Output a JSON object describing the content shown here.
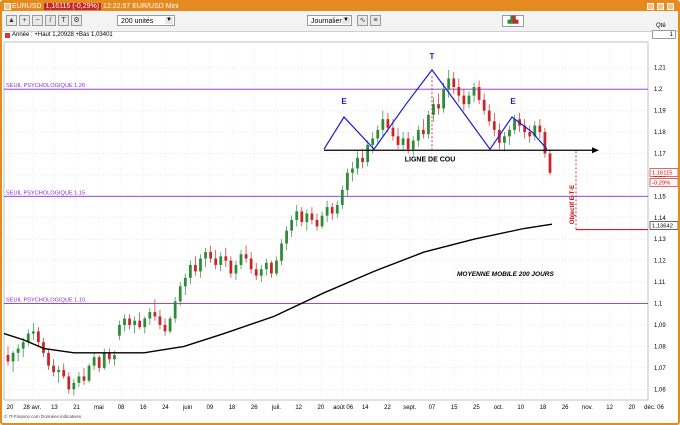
{
  "window": {
    "title": "EURUSD",
    "quote": "1,16115 (-0,29%)",
    "time": "12:22:57 EUR/USD Mini",
    "accent_color": "#e58a1f"
  },
  "toolbar": {
    "units_select": "200 unités",
    "period_select": "Journalier",
    "qty_label": "Qté",
    "qty_value": "1"
  },
  "infobar": {
    "text": "Année : +Haut 1,20928 +Bas 1,03401"
  },
  "footer": {
    "text": "© IT-Finance.com Données indicatives"
  },
  "chart_data": {
    "type": "candlestick",
    "ylim": [
      1.055,
      1.222
    ],
    "y_ticks": [
      "1,06",
      "1,07",
      "1,08",
      "1,09",
      "1,1",
      "1,11",
      "1,12",
      "1,13",
      "1,14",
      "1,15",
      "1,16",
      "1,17",
      "1,18",
      "1,19",
      "1,2",
      "1,21"
    ],
    "x_labels": [
      "20",
      "28 avr.",
      "13",
      "21",
      "mai",
      "08",
      "16",
      "24",
      "juin",
      "09",
      "18",
      "26",
      "juil.",
      "12",
      "20",
      "août 06",
      "14",
      "22",
      "sept.",
      "07",
      "15",
      "25",
      "oct.",
      "10",
      "18",
      "26",
      "nov.",
      "12",
      "20",
      "déc. 06"
    ],
    "price_labels": [
      {
        "value": 1.16115,
        "text": "1,16115",
        "color": "#d40000"
      },
      {
        "value": 1.1565,
        "text": "-0,29%",
        "color": "#d40000"
      },
      {
        "value": 1.13642,
        "text": "1,13642",
        "color": "#000000"
      }
    ],
    "horizontal_levels": [
      {
        "label": "SEUIL PSYCHOLOGIQUE 1.20",
        "value": 1.2,
        "color": "#8a2be2"
      },
      {
        "label": "SEUIL PSYCHOLOGIQUE 1.15",
        "value": 1.15,
        "color": "#8a2be2"
      },
      {
        "label": "SEUIL PSYCHOLOGIQUE 1.10",
        "value": 1.1,
        "color": "#8a2be2"
      }
    ],
    "annotations": {
      "neckline_label": "LIGNE DE COU",
      "ma_label": "MOYENNE MOBILE 200 JOURS",
      "target_label": "Objectif E-T-E",
      "left_shoulder": "E",
      "head": "T",
      "right_shoulder": "E",
      "pattern_color": "#1a1ad6",
      "target_color": "#d40000"
    },
    "up_color": "#2e8b3a",
    "down_color": "#c62828",
    "candles": [
      {
        "o": 1.076,
        "h": 1.08,
        "l": 1.071,
        "c": 1.073
      },
      {
        "o": 1.073,
        "h": 1.078,
        "l": 1.068,
        "c": 1.077
      },
      {
        "o": 1.077,
        "h": 1.081,
        "l": 1.073,
        "c": 1.079
      },
      {
        "o": 1.079,
        "h": 1.084,
        "l": 1.075,
        "c": 1.082
      },
      {
        "o": 1.082,
        "h": 1.088,
        "l": 1.08,
        "c": 1.086
      },
      {
        "o": 1.086,
        "h": 1.091,
        "l": 1.083,
        "c": 1.087
      },
      {
        "o": 1.087,
        "h": 1.089,
        "l": 1.08,
        "c": 1.082
      },
      {
        "o": 1.082,
        "h": 1.084,
        "l": 1.075,
        "c": 1.077
      },
      {
        "o": 1.077,
        "h": 1.079,
        "l": 1.069,
        "c": 1.071
      },
      {
        "o": 1.071,
        "h": 1.074,
        "l": 1.066,
        "c": 1.068
      },
      {
        "o": 1.068,
        "h": 1.071,
        "l": 1.063,
        "c": 1.069
      },
      {
        "o": 1.069,
        "h": 1.072,
        "l": 1.065,
        "c": 1.066
      },
      {
        "o": 1.066,
        "h": 1.068,
        "l": 1.058,
        "c": 1.06
      },
      {
        "o": 1.06,
        "h": 1.065,
        "l": 1.057,
        "c": 1.063
      },
      {
        "o": 1.063,
        "h": 1.068,
        "l": 1.061,
        "c": 1.066
      },
      {
        "o": 1.066,
        "h": 1.07,
        "l": 1.062,
        "c": 1.064
      },
      {
        "o": 1.064,
        "h": 1.072,
        "l": 1.063,
        "c": 1.071
      },
      {
        "o": 1.071,
        "h": 1.077,
        "l": 1.069,
        "c": 1.075
      },
      {
        "o": 1.075,
        "h": 1.076,
        "l": 1.068,
        "c": 1.07
      },
      {
        "o": 1.07,
        "h": 1.079,
        "l": 1.069,
        "c": 1.077
      },
      {
        "o": 1.077,
        "h": 1.079,
        "l": 1.072,
        "c": 1.074
      },
      {
        "o": 1.074,
        "h": 1.078,
        "l": 1.071,
        "c": 1.076
      },
      {
        "o": 1.085,
        "h": 1.092,
        "l": 1.083,
        "c": 1.09
      },
      {
        "o": 1.09,
        "h": 1.095,
        "l": 1.087,
        "c": 1.093
      },
      {
        "o": 1.093,
        "h": 1.095,
        "l": 1.088,
        "c": 1.09
      },
      {
        "o": 1.09,
        "h": 1.094,
        "l": 1.086,
        "c": 1.092
      },
      {
        "o": 1.092,
        "h": 1.096,
        "l": 1.088,
        "c": 1.089
      },
      {
        "o": 1.089,
        "h": 1.094,
        "l": 1.086,
        "c": 1.093
      },
      {
        "o": 1.093,
        "h": 1.098,
        "l": 1.09,
        "c": 1.096
      },
      {
        "o": 1.096,
        "h": 1.102,
        "l": 1.092,
        "c": 1.094
      },
      {
        "o": 1.094,
        "h": 1.097,
        "l": 1.088,
        "c": 1.09
      },
      {
        "o": 1.09,
        "h": 1.093,
        "l": 1.085,
        "c": 1.087
      },
      {
        "o": 1.087,
        "h": 1.094,
        "l": 1.086,
        "c": 1.093
      },
      {
        "o": 1.093,
        "h": 1.103,
        "l": 1.091,
        "c": 1.101
      },
      {
        "o": 1.101,
        "h": 1.11,
        "l": 1.099,
        "c": 1.108
      },
      {
        "o": 1.108,
        "h": 1.114,
        "l": 1.104,
        "c": 1.112
      },
      {
        "o": 1.112,
        "h": 1.12,
        "l": 1.109,
        "c": 1.118
      },
      {
        "o": 1.118,
        "h": 1.122,
        "l": 1.113,
        "c": 1.115
      },
      {
        "o": 1.115,
        "h": 1.123,
        "l": 1.112,
        "c": 1.121
      },
      {
        "o": 1.121,
        "h": 1.126,
        "l": 1.117,
        "c": 1.124
      },
      {
        "o": 1.124,
        "h": 1.127,
        "l": 1.119,
        "c": 1.121
      },
      {
        "o": 1.121,
        "h": 1.125,
        "l": 1.116,
        "c": 1.118
      },
      {
        "o": 1.118,
        "h": 1.124,
        "l": 1.115,
        "c": 1.122
      },
      {
        "o": 1.122,
        "h": 1.126,
        "l": 1.117,
        "c": 1.12
      },
      {
        "o": 1.12,
        "h": 1.122,
        "l": 1.112,
        "c": 1.114
      },
      {
        "o": 1.114,
        "h": 1.12,
        "l": 1.111,
        "c": 1.118
      },
      {
        "o": 1.118,
        "h": 1.125,
        "l": 1.116,
        "c": 1.123
      },
      {
        "o": 1.123,
        "h": 1.127,
        "l": 1.119,
        "c": 1.121
      },
      {
        "o": 1.121,
        "h": 1.124,
        "l": 1.114,
        "c": 1.116
      },
      {
        "o": 1.116,
        "h": 1.119,
        "l": 1.111,
        "c": 1.113
      },
      {
        "o": 1.113,
        "h": 1.118,
        "l": 1.11,
        "c": 1.116
      },
      {
        "o": 1.116,
        "h": 1.121,
        "l": 1.113,
        "c": 1.119
      },
      {
        "o": 1.119,
        "h": 1.12,
        "l": 1.112,
        "c": 1.114
      },
      {
        "o": 1.114,
        "h": 1.122,
        "l": 1.113,
        "c": 1.12
      },
      {
        "o": 1.12,
        "h": 1.13,
        "l": 1.118,
        "c": 1.128
      },
      {
        "o": 1.128,
        "h": 1.136,
        "l": 1.125,
        "c": 1.134
      },
      {
        "o": 1.134,
        "h": 1.141,
        "l": 1.131,
        "c": 1.139
      },
      {
        "o": 1.139,
        "h": 1.146,
        "l": 1.136,
        "c": 1.143
      },
      {
        "o": 1.143,
        "h": 1.145,
        "l": 1.136,
        "c": 1.138
      },
      {
        "o": 1.138,
        "h": 1.144,
        "l": 1.134,
        "c": 1.142
      },
      {
        "o": 1.142,
        "h": 1.145,
        "l": 1.137,
        "c": 1.139
      },
      {
        "o": 1.139,
        "h": 1.142,
        "l": 1.134,
        "c": 1.136
      },
      {
        "o": 1.136,
        "h": 1.143,
        "l": 1.135,
        "c": 1.141
      },
      {
        "o": 1.141,
        "h": 1.148,
        "l": 1.138,
        "c": 1.145
      },
      {
        "o": 1.145,
        "h": 1.147,
        "l": 1.139,
        "c": 1.142
      },
      {
        "o": 1.142,
        "h": 1.148,
        "l": 1.14,
        "c": 1.146
      },
      {
        "o": 1.146,
        "h": 1.155,
        "l": 1.144,
        "c": 1.153
      },
      {
        "o": 1.153,
        "h": 1.163,
        "l": 1.15,
        "c": 1.161
      },
      {
        "o": 1.161,
        "h": 1.166,
        "l": 1.157,
        "c": 1.163
      },
      {
        "o": 1.163,
        "h": 1.171,
        "l": 1.16,
        "c": 1.168
      },
      {
        "o": 1.168,
        "h": 1.172,
        "l": 1.163,
        "c": 1.166
      },
      {
        "o": 1.166,
        "h": 1.176,
        "l": 1.164,
        "c": 1.174
      },
      {
        "o": 1.174,
        "h": 1.18,
        "l": 1.17,
        "c": 1.177
      },
      {
        "o": 1.177,
        "h": 1.183,
        "l": 1.174,
        "c": 1.181
      },
      {
        "o": 1.181,
        "h": 1.19,
        "l": 1.178,
        "c": 1.186
      },
      {
        "o": 1.186,
        "h": 1.189,
        "l": 1.18,
        "c": 1.182
      },
      {
        "o": 1.182,
        "h": 1.186,
        "l": 1.176,
        "c": 1.178
      },
      {
        "o": 1.178,
        "h": 1.182,
        "l": 1.172,
        "c": 1.174
      },
      {
        "o": 1.174,
        "h": 1.18,
        "l": 1.171,
        "c": 1.177
      },
      {
        "o": 1.177,
        "h": 1.18,
        "l": 1.17,
        "c": 1.172
      },
      {
        "o": 1.172,
        "h": 1.178,
        "l": 1.169,
        "c": 1.176
      },
      {
        "o": 1.176,
        "h": 1.183,
        "l": 1.173,
        "c": 1.181
      },
      {
        "o": 1.181,
        "h": 1.186,
        "l": 1.177,
        "c": 1.179
      },
      {
        "o": 1.179,
        "h": 1.19,
        "l": 1.177,
        "c": 1.188
      },
      {
        "o": 1.188,
        "h": 1.196,
        "l": 1.185,
        "c": 1.193
      },
      {
        "o": 1.193,
        "h": 1.198,
        "l": 1.188,
        "c": 1.191
      },
      {
        "o": 1.191,
        "h": 1.203,
        "l": 1.189,
        "c": 1.2
      },
      {
        "o": 1.2,
        "h": 1.209,
        "l": 1.196,
        "c": 1.205
      },
      {
        "o": 1.205,
        "h": 1.208,
        "l": 1.198,
        "c": 1.201
      },
      {
        "o": 1.201,
        "h": 1.205,
        "l": 1.194,
        "c": 1.197
      },
      {
        "o": 1.197,
        "h": 1.2,
        "l": 1.19,
        "c": 1.193
      },
      {
        "o": 1.193,
        "h": 1.199,
        "l": 1.191,
        "c": 1.197
      },
      {
        "o": 1.197,
        "h": 1.203,
        "l": 1.194,
        "c": 1.201
      },
      {
        "o": 1.201,
        "h": 1.204,
        "l": 1.193,
        "c": 1.195
      },
      {
        "o": 1.195,
        "h": 1.198,
        "l": 1.188,
        "c": 1.19
      },
      {
        "o": 1.19,
        "h": 1.193,
        "l": 1.183,
        "c": 1.185
      },
      {
        "o": 1.185,
        "h": 1.189,
        "l": 1.178,
        "c": 1.181
      },
      {
        "o": 1.181,
        "h": 1.184,
        "l": 1.172,
        "c": 1.175
      },
      {
        "o": 1.175,
        "h": 1.18,
        "l": 1.171,
        "c": 1.178
      },
      {
        "o": 1.178,
        "h": 1.183,
        "l": 1.174,
        "c": 1.181
      },
      {
        "o": 1.181,
        "h": 1.188,
        "l": 1.179,
        "c": 1.186
      },
      {
        "o": 1.186,
        "h": 1.189,
        "l": 1.18,
        "c": 1.183
      },
      {
        "o": 1.183,
        "h": 1.186,
        "l": 1.177,
        "c": 1.18
      },
      {
        "o": 1.18,
        "h": 1.183,
        "l": 1.175,
        "c": 1.178
      },
      {
        "o": 1.178,
        "h": 1.185,
        "l": 1.176,
        "c": 1.183
      },
      {
        "o": 1.183,
        "h": 1.186,
        "l": 1.177,
        "c": 1.18
      },
      {
        "o": 1.18,
        "h": 1.182,
        "l": 1.168,
        "c": 1.17
      },
      {
        "o": 1.17,
        "h": 1.172,
        "l": 1.16,
        "c": 1.161
      }
    ]
  }
}
